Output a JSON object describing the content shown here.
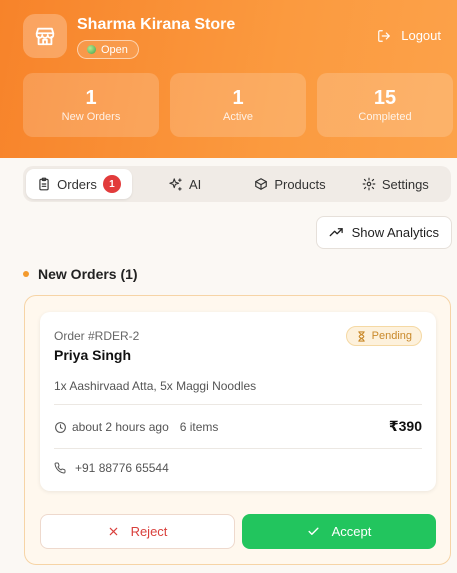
{
  "header": {
    "store_name": "Sharma Kirana Store",
    "status": "Open",
    "logout_label": "Logout",
    "stats": [
      {
        "value": "1",
        "label": "New Orders"
      },
      {
        "value": "1",
        "label": "Active"
      },
      {
        "value": "15",
        "label": "Completed"
      }
    ]
  },
  "tabs": [
    {
      "label": "Orders",
      "badge": "1",
      "icon": "clipboard-icon"
    },
    {
      "label": "AI",
      "icon": "sparkles-icon"
    },
    {
      "label": "Products",
      "icon": "box-icon"
    },
    {
      "label": "Settings",
      "icon": "gear-icon"
    }
  ],
  "analytics_button": "Show Analytics",
  "section_title": "New Orders (1)",
  "order": {
    "id": "Order #RDER-2",
    "customer": "Priya Singh",
    "status": "Pending",
    "items": "1x Aashirvaad Atta, 5x Maggi Noodles",
    "time": "about 2 hours ago",
    "item_count": "6 items",
    "total": "₹390",
    "phone": "+91 88776 65544",
    "reject_label": "Reject",
    "accept_label": "Accept"
  },
  "colors": {
    "brand_orange": "#f7832a",
    "accept_green": "#22c55e",
    "reject_red": "#d9403c",
    "pending_amber": "#c9892a"
  }
}
